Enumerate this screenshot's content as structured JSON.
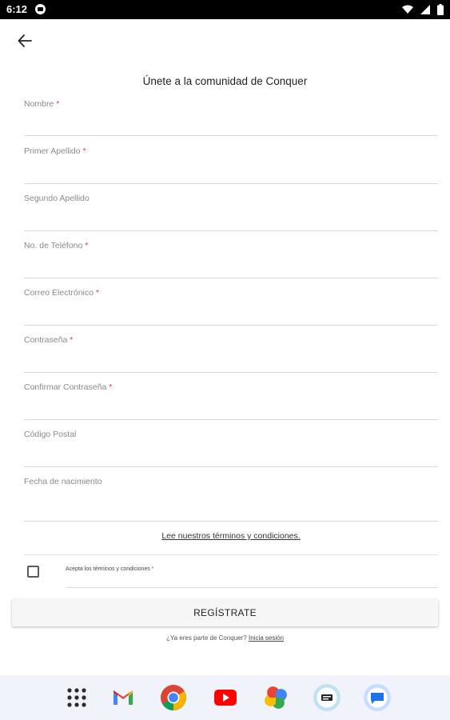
{
  "status_bar": {
    "time": "6:12"
  },
  "header": {
    "title": "Únete a la comunidad de Conquer"
  },
  "form": {
    "required_marker": "*",
    "fields": [
      {
        "label": "Nombre",
        "required": true,
        "value": ""
      },
      {
        "label": "Primer Apellido",
        "required": true,
        "value": ""
      },
      {
        "label": "Segundo Apellido",
        "required": false,
        "value": ""
      },
      {
        "label": "No. de Teléfono",
        "required": true,
        "value": ""
      },
      {
        "label": "Correo Electrónico",
        "required": true,
        "value": ""
      },
      {
        "label": "Contraseña",
        "required": true,
        "value": ""
      },
      {
        "label": "Confirmar Contraseña",
        "required": true,
        "value": ""
      },
      {
        "label": "Código Postal",
        "required": false,
        "value": ""
      },
      {
        "label": "Fecha de nacimiento",
        "required": false,
        "value": ""
      }
    ],
    "terms_link": "Lee nuestros términos y condiciones.",
    "accept_label": "Acepta los términos y condiciones",
    "accept_checked": false,
    "register_button": "REGÍSTRATE",
    "login_prompt": "¿Ya eres parte de Conquer?",
    "login_link": "Inicia sesión"
  },
  "dock": {
    "apps": [
      "app-drawer-icon",
      "gmail-icon",
      "chrome-icon",
      "youtube-icon",
      "photos-icon",
      "news-app-icon",
      "messages-icon"
    ]
  }
}
